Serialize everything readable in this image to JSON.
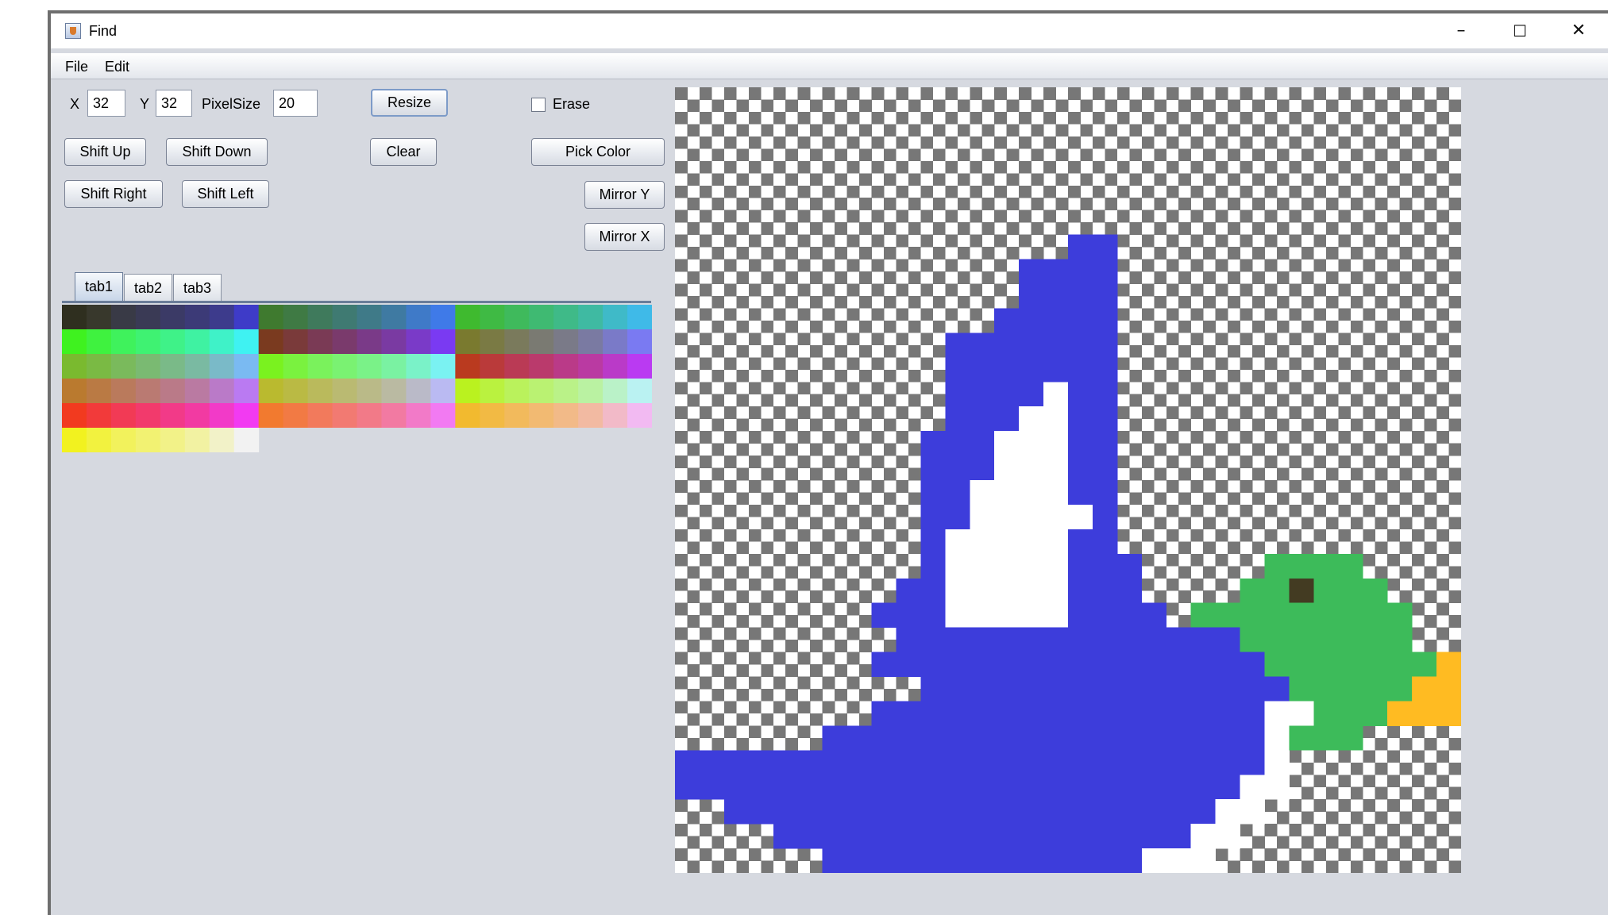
{
  "window": {
    "title": "Find",
    "controls": [
      "–",
      "☐",
      "✕"
    ],
    "icons": {
      "app": "java-cup-icon",
      "minimize": "minimize-icon",
      "maximize": "maximize-icon",
      "close": "close-icon"
    }
  },
  "menubar": {
    "items": [
      "File",
      "Edit"
    ]
  },
  "controls": {
    "x_label": "X",
    "x_value": "32",
    "y_label": "Y",
    "y_value": "32",
    "pixelsize_label": "PixelSize",
    "pixelsize_value": "20",
    "resize": "Resize",
    "erase": "Erase",
    "erase_checked": false,
    "shift_up": "Shift Up",
    "shift_down": "Shift Down",
    "clear": "Clear",
    "pick_color": "Pick Color",
    "shift_right": "Shift Right",
    "shift_left": "Shift Left",
    "mirror_y": "Mirror Y",
    "mirror_x": "Mirror X"
  },
  "tabs": {
    "items": [
      "tab1",
      "tab2",
      "tab3"
    ],
    "selected": 0
  },
  "palette": {
    "rows": [
      [
        "#2f2f1f",
        "#38382c",
        "#393a46",
        "#3a3a55",
        "#3b3a66",
        "#3c3a77",
        "#3d3b8c",
        "#3e3bc8",
        "#3f7a2f",
        "#3f7a44",
        "#3f7a5c",
        "#3f7a72",
        "#3f7a88",
        "#3f7aa2",
        "#3f7ac8",
        "#3f7ae8",
        "#3fba2f",
        "#3fba44",
        "#3fba5c",
        "#3fba72",
        "#3fba88",
        "#3fbaa2",
        "#3fbac8",
        "#3fbae8"
      ],
      [
        "#3ff21f",
        "#3ff23f",
        "#3ff25c",
        "#3ff272",
        "#3ff288",
        "#3ff2a2",
        "#3ff2c8",
        "#3ff2f2",
        "#7a3a1f",
        "#7a3a3a",
        "#7a3a55",
        "#7a3a6c",
        "#7a3a88",
        "#7a3aa2",
        "#7a3ac8",
        "#7a3af2",
        "#7a7a2f",
        "#7a7a44",
        "#7a7a5c",
        "#7a7a72",
        "#7a7a88",
        "#7a7aa2",
        "#7a7ac8",
        "#7a7af2"
      ],
      [
        "#7aba2f",
        "#7aba44",
        "#7aba5c",
        "#7aba72",
        "#7aba88",
        "#7abaa2",
        "#7abac8",
        "#7abaf2",
        "#7af21f",
        "#7af23f",
        "#7af25c",
        "#7af272",
        "#7af288",
        "#7af2a2",
        "#7af2c8",
        "#7af2f2",
        "#ba3a1f",
        "#ba3a3a",
        "#ba3a55",
        "#ba3a6c",
        "#ba3a88",
        "#ba3aa2",
        "#ba3ac8",
        "#ba3af2"
      ],
      [
        "#ba7a2f",
        "#ba7a44",
        "#ba7a5c",
        "#ba7a72",
        "#ba7a88",
        "#ba7aa2",
        "#ba7ac8",
        "#ba7af2",
        "#baba2f",
        "#baba44",
        "#baba5c",
        "#baba72",
        "#baba88",
        "#babaa2",
        "#babac8",
        "#babaf2",
        "#baf21f",
        "#baf23f",
        "#baf25c",
        "#baf272",
        "#baf288",
        "#baf2a2",
        "#baf2c8",
        "#baf2f2"
      ],
      [
        "#f23a1f",
        "#f23a3a",
        "#f23a55",
        "#f23a6c",
        "#f23a88",
        "#f23aa2",
        "#f23ac8",
        "#f23af2",
        "#f27a2f",
        "#f27a44",
        "#f27a5c",
        "#f27a72",
        "#f27a88",
        "#f27aa2",
        "#f27ac8",
        "#f27af2",
        "#f2ba2f",
        "#f2ba44",
        "#f2ba5c",
        "#f2ba72",
        "#f2ba88",
        "#f2baa2",
        "#f2bac8",
        "#f2baf2"
      ],
      [
        "#f2f21f",
        "#f2f23f",
        "#f2f25c",
        "#f2f272",
        "#f2f288",
        "#f2f2a2",
        "#f2f2c8",
        "#f2f2f2"
      ]
    ]
  },
  "image": {
    "grid_size": 32,
    "checker_dark": "#777777",
    "checker_light": "#ffffff",
    "colors": {
      "B": "#3d3ddb",
      "W": "#ffffff",
      "G": "#3dbb5a",
      "O": "#ffbb22",
      "K": "#433b22"
    },
    "rows": [
      "................................",
      "................................",
      "................................",
      "................................",
      "................................",
      "................................",
      "................BB..............",
      "..............BBBB..............",
      "..............BBBB..............",
      ".............BBBBB..............",
      "...........BBBBBBB..............",
      "...........BBBBBBB..............",
      "...........BBBBWBB..............",
      "...........BBBWWBB..............",
      "..........BBBWWWBB..............",
      "..........BBBWWWBB..............",
      "..........BBWWWWBB..............",
      "..........BBWWWWWB..............",
      "..........BWWWWWBB..............",
      "..........BWWWWWBBB.....GGGG....",
      ".........BBWWWWWBBB....GGKGGG...",
      "........BBBWWWWWBBBB.GGGGGGGGG..",
      ".........BBBBBBBBBBBBBBGGGGGGG..",
      "........BBBBBBBBBBBBBBBBGGGGGGGO",
      "..........BBBBBBBBBBBBBBBGGGGGOO",
      "........BBBBBBBBBBBBBBBBWWGGGOOO",
      "......BBBBBBBBBBBBBBBBBBWGGG....",
      "BBBBBBBBBBBBBBBBBBBBBBBBW.......",
      "BBBBBBBBBBBBBBBBBBBBBBBWW.......",
      "..BBBBBBBBBBBBBBBBBBBBWW........",
      "....BBBBBBBBBBBBBBBBBWW.........",
      "......BBBBBBBBBBBBBWWW.........."
    ]
  }
}
